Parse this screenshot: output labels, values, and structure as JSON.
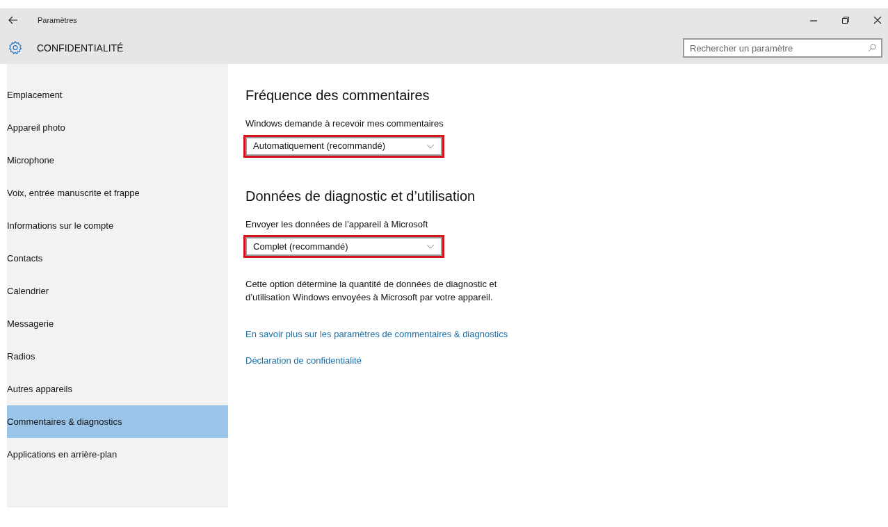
{
  "window": {
    "title": "Paramètres"
  },
  "header": {
    "title": "CONFIDENTIALITÉ"
  },
  "search": {
    "placeholder": "Rechercher un paramètre"
  },
  "sidebar": {
    "items": [
      {
        "label": "Emplacement",
        "selected": false
      },
      {
        "label": "Appareil photo",
        "selected": false
      },
      {
        "label": "Microphone",
        "selected": false
      },
      {
        "label": "Voix, entrée manuscrite et frappe",
        "selected": false
      },
      {
        "label": "Informations sur le compte",
        "selected": false
      },
      {
        "label": "Contacts",
        "selected": false
      },
      {
        "label": "Calendrier",
        "selected": false
      },
      {
        "label": "Messagerie",
        "selected": false
      },
      {
        "label": "Radios",
        "selected": false
      },
      {
        "label": "Autres appareils",
        "selected": false
      },
      {
        "label": "Commentaires & diagnostics",
        "selected": true
      },
      {
        "label": "Applications en arrière-plan",
        "selected": false
      }
    ]
  },
  "sections": [
    {
      "heading": "Fréquence des commentaires",
      "label": "Windows demande à recevoir mes commentaires",
      "dropdown": {
        "value": "Automatiquement (recommandé)",
        "highlighted": true
      }
    },
    {
      "heading": "Données de diagnostic et d’utilisation",
      "label": "Envoyer les données de l’appareil à Microsoft",
      "dropdown": {
        "value": "Complet (recommandé)",
        "highlighted": true
      },
      "description": "Cette option détermine la quantité de données de diagnostic et d’utilisation Windows envoyées à Microsoft par votre appareil."
    }
  ],
  "links": [
    "En savoir plus sur les paramètres de commentaires & diagnostics",
    "Déclaration de confidentialité"
  ]
}
